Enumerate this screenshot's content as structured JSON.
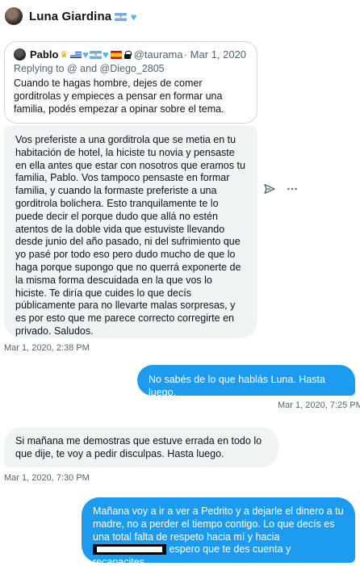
{
  "header": {
    "name": "Luna Giardina"
  },
  "quoted_tweet": {
    "author": "Pablo",
    "handle": "@taurama",
    "date": "· Mar 1, 2020",
    "replying_to": "Replying to @ and @Diego_2805",
    "text": "Cuando te hagas hombre, dejes de comer gorditrolas y empieces a pensar en formar una familia, podés empezar a opinar sobre el tema."
  },
  "messages": [
    {
      "direction": "incoming",
      "text": "Vos preferiste a una gorditrola que se metia en tu habitación de hotel, la hiciste tu novia y pensaste en ella antes que estar con nosotros que eramos tu familia, Pablo. Vos tampoco pensaste en formar familia, y cuando la formaste preferiste a una gorditrola bolichera. Esto tranquilamente te lo puede decir el porque dudo que allá no estén atentos de la doble vida que estuviste llevando desde junio del año pasado, ni del sufrimiento que yo pasé por todo eso pero dudo mucho de que lo haga porque supongo que no querrá exponerte de la misma forma descuidada en la que vos lo hiciste. Te diría que cuides lo que decís públicamente para no llevarte malas sorpresas, y es por esto que me parece correcto corregirte en privado. Saludos.",
      "timestamp": "Mar 1, 2020, 2:38 PM"
    },
    {
      "direction": "outgoing",
      "text": "No sabés de lo que hablás Luna. Hasta luego.",
      "timestamp": "Mar 1, 2020, 7:25 PM"
    },
    {
      "direction": "incoming",
      "text": "Si mañana me demostras que estuve errada en todo lo que dije, te voy a pedir disculpas. Hasta luego.",
      "timestamp": "Mar 1, 2020, 7:30 PM"
    },
    {
      "direction": "outgoing",
      "text_before_redaction": "Mañana voy a ir a ver a Pedrito y a dejarle el dinero a tu madre, no a perder el tiempo contigo. Lo que decís es una total falta de respeto hacia mí y hacia",
      "text_after_redaction": "espero que te des cuenta y recapacites."
    }
  ],
  "icons": {
    "share": "send-arrow-icon",
    "more": "more-dots-icon"
  },
  "colors": {
    "outgoing_bubble": "#1d9bf0",
    "incoming_bubble": "#eff3f4",
    "secondary_text": "#536471"
  }
}
